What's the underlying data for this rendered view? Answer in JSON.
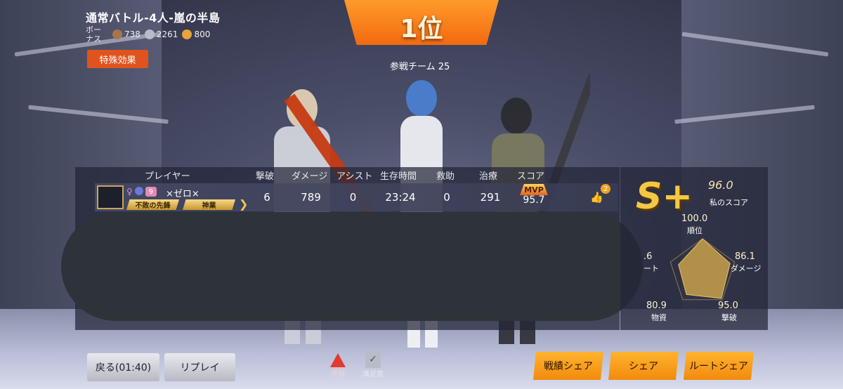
{
  "header": {
    "title": "通常バトル-4人-嵐の半島",
    "bonus_label": "ボーナス",
    "bonuses": [
      "738",
      "2261",
      "800"
    ],
    "effect_button": "特殊効果",
    "rank": "1位",
    "teams": "参戦チーム 25"
  },
  "table": {
    "headers": [
      "プレイヤー",
      "撃破",
      "ダメージ",
      "アシスト",
      "生存時間",
      "救助",
      "治療",
      "スコア"
    ],
    "player": {
      "name": "×ゼロ×",
      "level_badge": "9",
      "tags": [
        "不敗の先鋒",
        "神業"
      ],
      "kills": "6",
      "damage": "789",
      "assists": "0",
      "survival": "23:24",
      "rescues": "0",
      "heals": "291",
      "mvp_label": "MVP",
      "score": "95.7",
      "likes": "2"
    }
  },
  "my_score": {
    "grade": "S+",
    "value": "96.0",
    "label": "私のスコア",
    "radar": {
      "rank": {
        "value": "100.0",
        "label": "順位"
      },
      "damage": {
        "value": "86.1",
        "label": "ダメージ"
      },
      "kills": {
        "value": "95.0",
        "label": "撃破"
      },
      "supplies": {
        "value": "80.9",
        "label": "物資"
      },
      "route": {
        "value": ".6",
        "label": "ート"
      }
    },
    "radar_levels": [
      1.0,
      0.861,
      0.95,
      0.809,
      0.75
    ]
  },
  "buttons": {
    "back": "戻る(01:40)",
    "replay": "リプレイ",
    "report": "通報",
    "satisfaction": "満足度",
    "stats_share": "戦績シェア",
    "share": "シェア",
    "route_share": "ルートシェア"
  },
  "colors": {
    "accent_orange": "#f28a0d",
    "gold": "#f5c744",
    "effect_red": "#e0531e"
  }
}
